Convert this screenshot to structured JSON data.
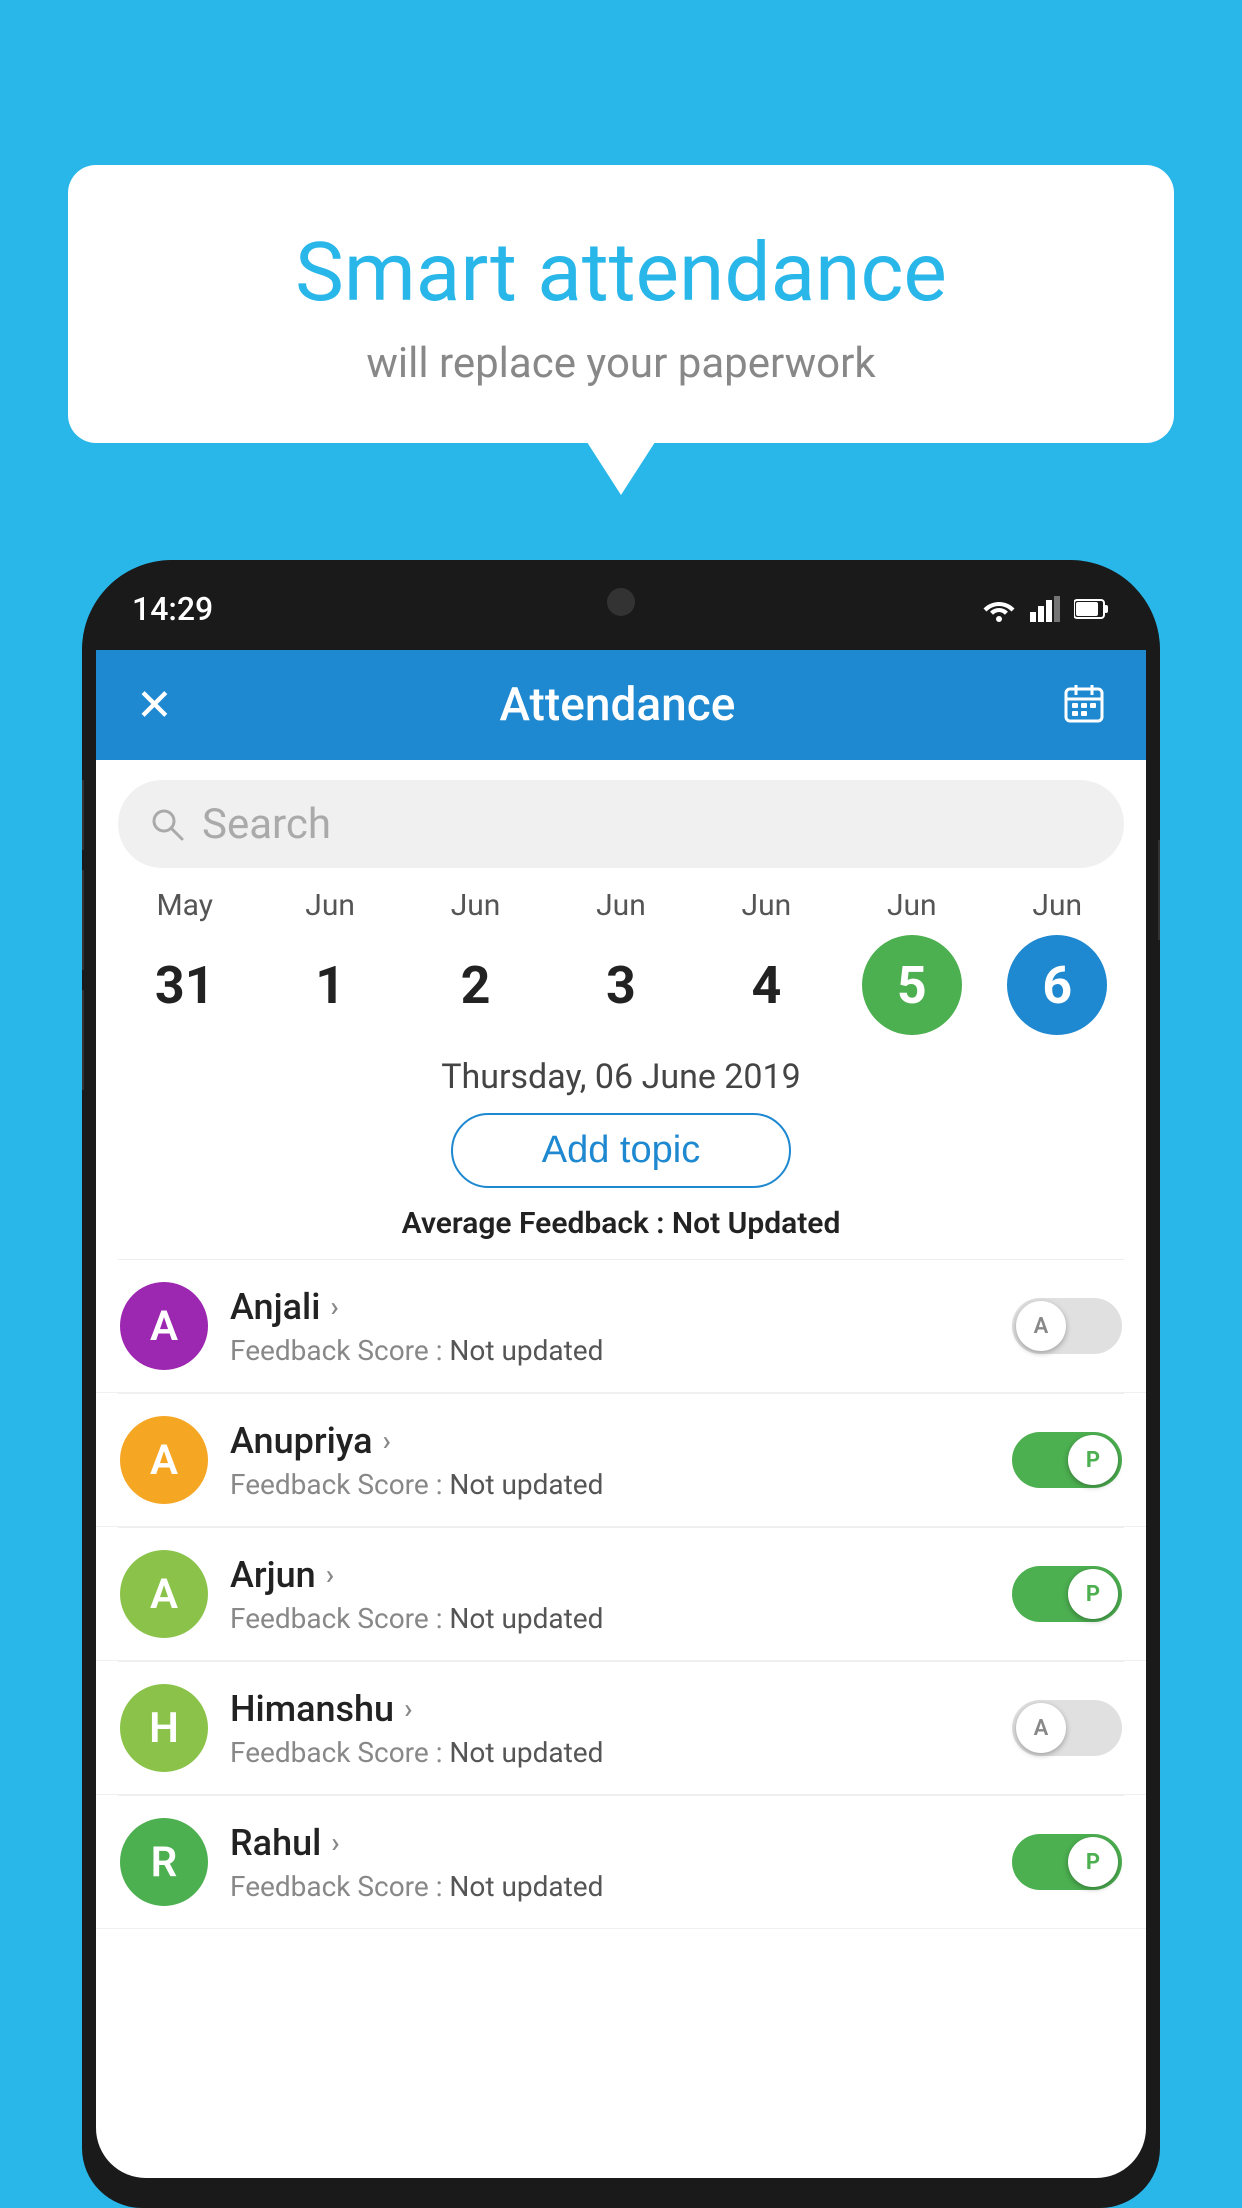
{
  "background_color": "#29b6e8",
  "speech_bubble": {
    "title": "Smart attendance",
    "subtitle": "will replace your paperwork"
  },
  "status_bar": {
    "time": "14:29",
    "icons": [
      "wifi",
      "signal",
      "battery"
    ]
  },
  "header": {
    "title": "Attendance",
    "close_label": "✕",
    "calendar_icon": "calendar"
  },
  "search": {
    "placeholder": "Search"
  },
  "calendar": {
    "dates": [
      {
        "month": "May",
        "day": "31",
        "state": "normal"
      },
      {
        "month": "Jun",
        "day": "1",
        "state": "normal"
      },
      {
        "month": "Jun",
        "day": "2",
        "state": "normal"
      },
      {
        "month": "Jun",
        "day": "3",
        "state": "normal"
      },
      {
        "month": "Jun",
        "day": "4",
        "state": "normal"
      },
      {
        "month": "Jun",
        "day": "5",
        "state": "today"
      },
      {
        "month": "Jun",
        "day": "6",
        "state": "selected"
      }
    ],
    "selected_date_label": "Thursday, 06 June 2019"
  },
  "add_topic": {
    "label": "Add topic"
  },
  "average_feedback": {
    "label": "Average Feedback :",
    "value": "Not Updated"
  },
  "students": [
    {
      "name": "Anjali",
      "initial": "A",
      "avatar_color": "#9c27b0",
      "feedback_label": "Feedback Score :",
      "feedback_value": "Not updated",
      "toggle": "off",
      "toggle_label": "A"
    },
    {
      "name": "Anupriya",
      "initial": "A",
      "avatar_color": "#f5a623",
      "feedback_label": "Feedback Score :",
      "feedback_value": "Not updated",
      "toggle": "on",
      "toggle_label": "P"
    },
    {
      "name": "Arjun",
      "initial": "A",
      "avatar_color": "#8bc34a",
      "feedback_label": "Feedback Score :",
      "feedback_value": "Not updated",
      "toggle": "on",
      "toggle_label": "P"
    },
    {
      "name": "Himanshu",
      "initial": "H",
      "avatar_color": "#8bc34a",
      "feedback_label": "Feedback Score :",
      "feedback_value": "Not updated",
      "toggle": "off",
      "toggle_label": "A"
    },
    {
      "name": "Rahul",
      "initial": "R",
      "avatar_color": "#4caf50",
      "feedback_label": "Feedback Score :",
      "feedback_value": "Not updated",
      "toggle": "on",
      "toggle_label": "P"
    }
  ]
}
